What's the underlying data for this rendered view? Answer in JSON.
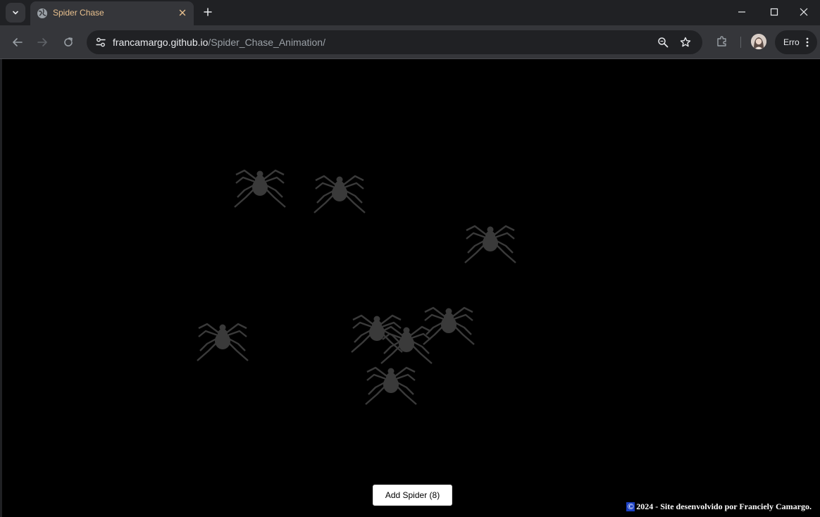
{
  "browser": {
    "tab": {
      "title": "Spider Chase"
    },
    "address": {
      "host": "francamargo.github.io",
      "path": "/Spider_Chase_Animation/"
    },
    "profile_label": "Erro"
  },
  "page": {
    "background": "#000000",
    "spider_color": "#3a3a3a",
    "spider_count": 8,
    "add_button_label": "Add Spider (8)",
    "footer": {
      "copyright_symbol": "©",
      "text": "2024 - Site desenvolvido por Franciely Camargo."
    }
  },
  "icons": {
    "tab_search": "chevron-down-icon",
    "favicon": "globe-icon",
    "tab_close": "close-icon",
    "new_tab": "plus-icon",
    "back": "arrow-left-icon",
    "forward": "arrow-right-icon",
    "reload": "reload-icon",
    "site_info": "tune-icon",
    "zoom": "magnifier-icon",
    "bookmark": "star-icon",
    "extensions": "puzzle-icon",
    "menu": "kebab-icon"
  }
}
